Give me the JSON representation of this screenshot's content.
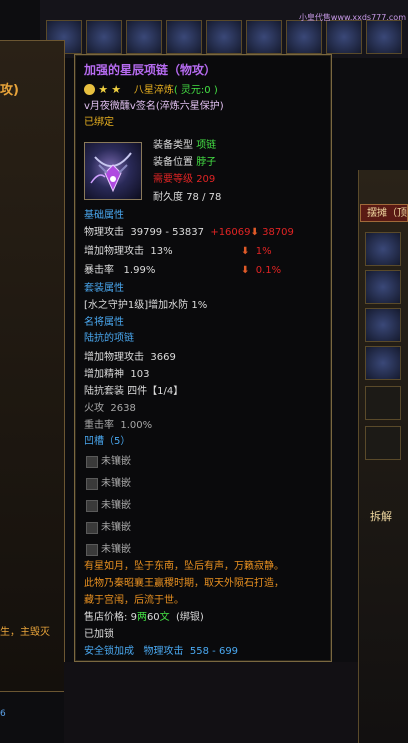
{
  "background": {
    "left_title": "攻)",
    "left_text": "生，主毁灭",
    "left_num": "6",
    "watermark": "小皇代售www.xxds777.com",
    "stall_label": "摆摊（顶",
    "split_label": "拆解"
  },
  "tooltip": {
    "title": "加强的星辰项链（物攻）",
    "star_rank": "八星淬炼",
    "spirit": "( 灵元:0 )",
    "signature": "v月夜微醺v签名(淬炼六星保护)",
    "bound": "已绑定",
    "item_info": {
      "type_label": "装备类型",
      "type_value": "项链",
      "position_label": "装备位置",
      "position_value": "脖子",
      "level_label": "需要等级",
      "level_value": "209",
      "durability_label": "耐久度",
      "durability_value": "78 / 78"
    },
    "base_attr_header": "基础属性",
    "base_attrs": {
      "phys_attack_label": "物理攻击",
      "phys_attack_value": "39799 - 53837",
      "phys_attack_bonus": "+16069",
      "phys_attack_extra": "38709",
      "phys_pct_label": "增加物理攻击",
      "phys_pct_value": "13%",
      "phys_pct_extra": "1%",
      "crit_label": "暴击率",
      "crit_value": "1.99%",
      "crit_extra": "0.1%"
    },
    "set_attr_header": "套装属性",
    "set_attr_value": "[水之守护1级]增加水防 1%",
    "famous_header": "名将属性",
    "famous_name": "陆抗的项链",
    "famous_attrs": [
      {
        "label": "增加物理攻击",
        "value": "3669"
      },
      {
        "label": "增加精神",
        "value": "103"
      }
    ],
    "set_name": "陆抗套装  四件【1/4】",
    "set_bonuses": [
      {
        "label": "火攻",
        "value": "2638"
      },
      {
        "label": "重击率",
        "value": "1.00%"
      }
    ],
    "socket_header": "凹槽（5）",
    "sockets": [
      "未镶嵌",
      "未镶嵌",
      "未镶嵌",
      "未镶嵌",
      "未镶嵌"
    ],
    "lore": [
      "有星如月，坠于东南，坠后有声，万籁寂静。",
      "此物乃秦昭襄王赢稷时期，取天外陨石打造，",
      "藏于宫闱，后流于世。"
    ],
    "price_label": "售店价格:",
    "price_gold": "9",
    "price_gold_unit": "两",
    "price_silver": "60",
    "price_silver_unit": "文",
    "price_note": "(绑银)",
    "locked": "已加锁",
    "safety_lock": "安全锁加成",
    "safety_attr_label": "物理攻击",
    "safety_attr_value": "558 - 699"
  }
}
